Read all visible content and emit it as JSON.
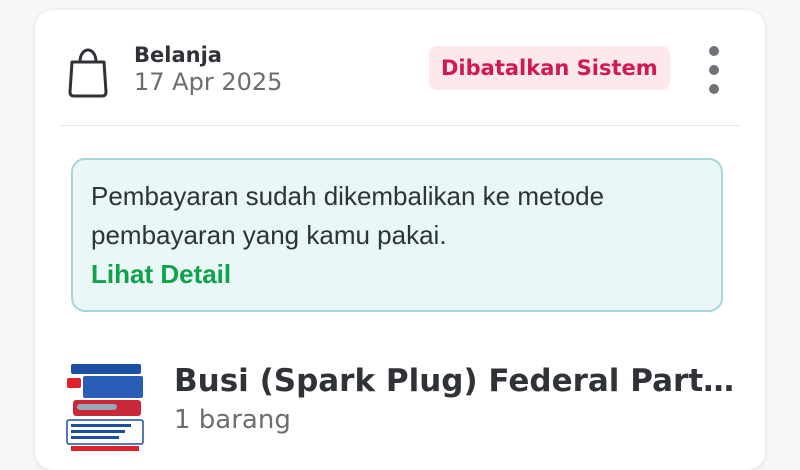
{
  "order": {
    "shop_type": "Belanja",
    "date": "17 Apr 2025",
    "status": "Dibatalkan Sistem"
  },
  "info": {
    "message": "Pembayaran sudah dikembalikan ke metode pembayaran yang kamu pakai.",
    "link_label": "Lihat Detail"
  },
  "product": {
    "title": "Busi (Spark Plug) Federal Parts Original",
    "quantity": "1 barang"
  },
  "colors": {
    "status_text": "#d2184f",
    "status_bg": "#fde8ec",
    "link": "#0fa24b",
    "info_bg": "#e9f7f7",
    "info_border": "#a8d6d8"
  },
  "icons": {
    "header": "shopping-bag-icon",
    "menu": "more-vertical-icon"
  }
}
